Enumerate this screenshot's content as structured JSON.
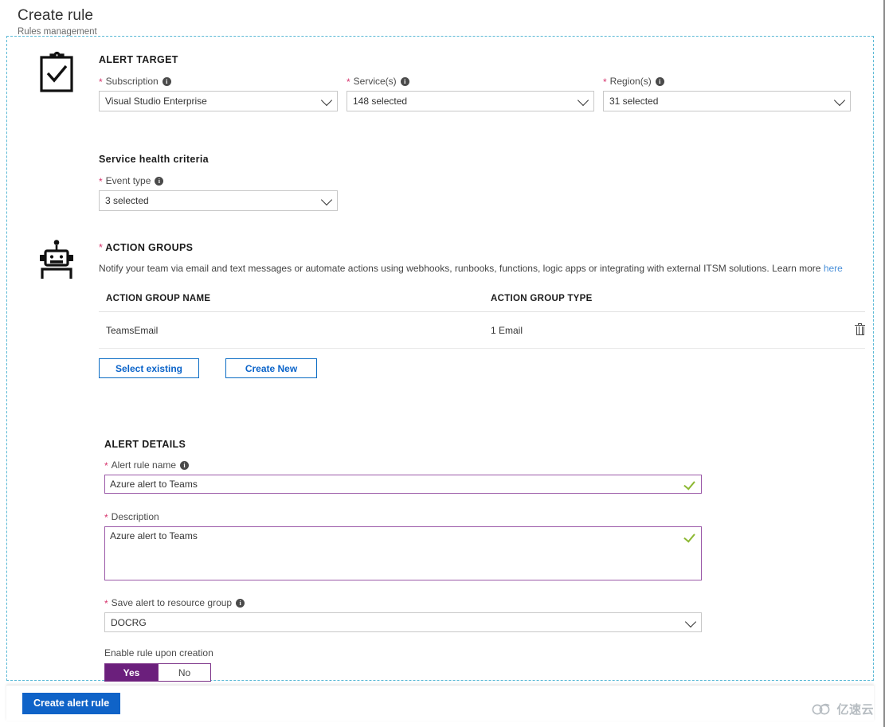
{
  "header": {
    "title": "Create rule",
    "subtitle": "Rules management"
  },
  "alert_target": {
    "section_title": "ALERT TARGET",
    "fields": [
      {
        "label": "Subscription",
        "value": "Visual Studio Enterprise",
        "required": true,
        "has_info": true
      },
      {
        "label": "Service(s)",
        "value": "148 selected",
        "required": true,
        "has_info": true
      },
      {
        "label": "Region(s)",
        "value": "31 selected",
        "required": true,
        "has_info": true
      }
    ],
    "criteria_title": "Service health criteria",
    "event_type": {
      "label": "Event type",
      "value": "3 selected",
      "required": true,
      "has_info": true
    }
  },
  "action_groups": {
    "section_title": "ACTION GROUPS",
    "required_marker": "*",
    "description": "Notify your team via email and text messages or automate actions using webhooks, runbooks, functions, logic apps or integrating with external ITSM solutions. Learn more",
    "link_text": "here",
    "columns": [
      "ACTION GROUP NAME",
      "ACTION GROUP TYPE"
    ],
    "rows": [
      {
        "name": "TeamsEmail",
        "type": "1 Email"
      }
    ],
    "buttons": {
      "select_existing": "Select existing",
      "create_new": "Create New"
    }
  },
  "alert_details": {
    "section_title": "ALERT DETAILS",
    "rule_name": {
      "label": "Alert rule name",
      "value": "Azure alert to Teams",
      "required": true,
      "has_info": true,
      "valid": true
    },
    "description": {
      "label": "Description",
      "value": "Azure alert to Teams",
      "required": true,
      "has_info": false,
      "valid": true
    },
    "resource_group": {
      "label": "Save alert to resource group",
      "value": "DOCRG",
      "required": true,
      "has_info": true
    },
    "enable_rule": {
      "label": "Enable rule upon creation",
      "options": [
        "Yes",
        "No"
      ],
      "selected": "Yes"
    }
  },
  "footer": {
    "create_button": "Create alert rule"
  },
  "watermark": {
    "text": "亿速云"
  },
  "colors": {
    "accent_blue": "#0f63c8",
    "link_blue": "#4a90d9",
    "required_pink": "#d6336c",
    "validated_purple": "#9b59a8",
    "toggle_purple": "#6b1f7c",
    "check_green": "#8cb832",
    "frame_dashed": "#5bb9d6"
  }
}
